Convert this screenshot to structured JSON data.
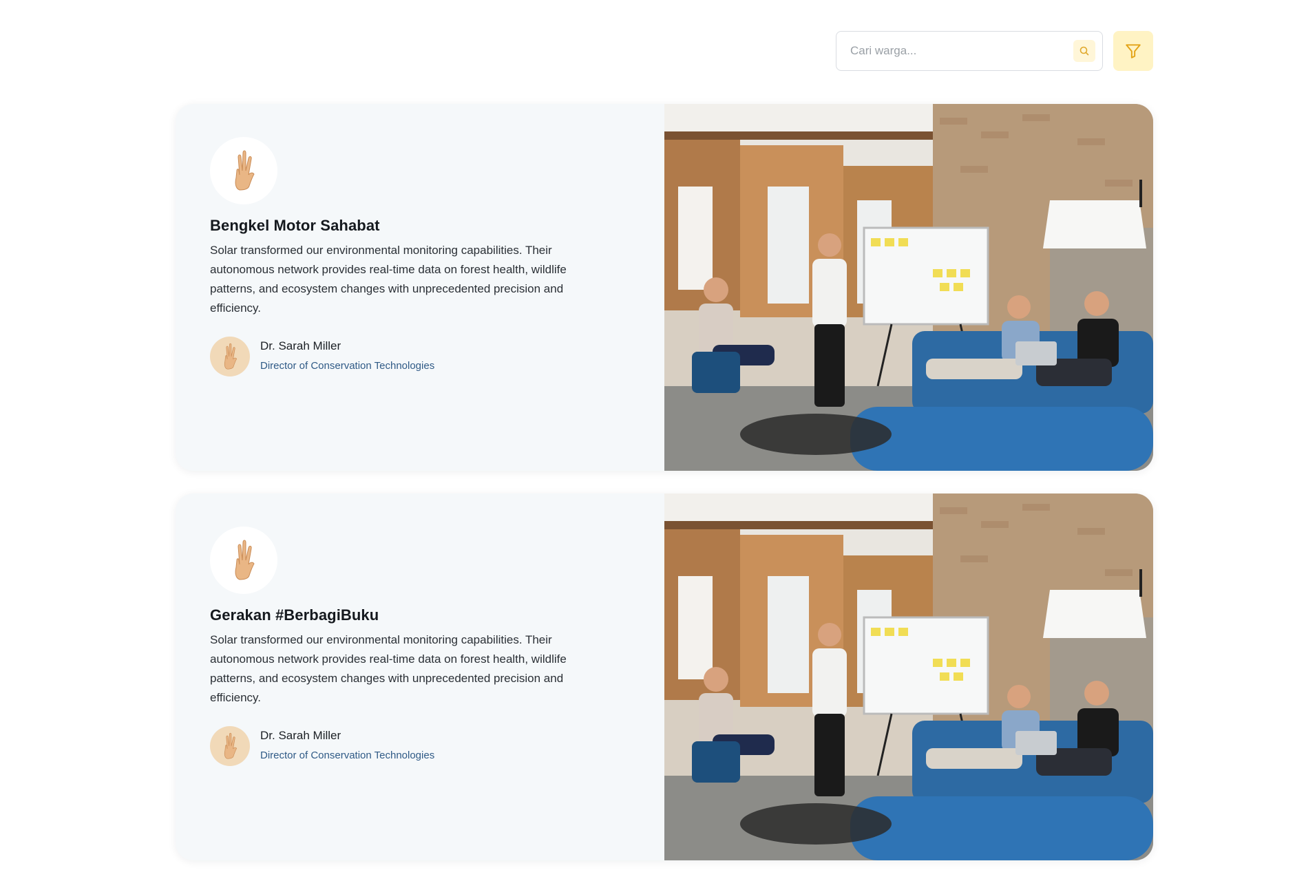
{
  "search": {
    "placeholder": "Cari warga..."
  },
  "icons": {
    "search": "search-icon",
    "filter": "filter-icon",
    "avatar": "hand-peace-icon"
  },
  "colors": {
    "accent": "#f4c430",
    "filter_bg": "#fff3c4",
    "card_bg": "#f5f8fa",
    "role_text": "#2f5a86"
  },
  "cards": [
    {
      "title": "Bengkel Motor Sahabat",
      "description": "Solar transformed our environmental monitoring capabilities. Their autonomous network provides real-time data on forest health, wildlife patterns, and ecosystem changes with unprecedented precision and efficiency.",
      "person_name": "Dr. Sarah Miller",
      "person_role": "Director of Conservation Technologies"
    },
    {
      "title": "Gerakan #BerbagiBuku",
      "description": "Solar transformed our environmental monitoring capabilities. Their autonomous network provides real-time data on forest health, wildlife patterns, and ecosystem changes with unprecedented precision and efficiency.",
      "person_name": "Dr. Sarah Miller",
      "person_role": "Director of Conservation Technologies"
    }
  ]
}
